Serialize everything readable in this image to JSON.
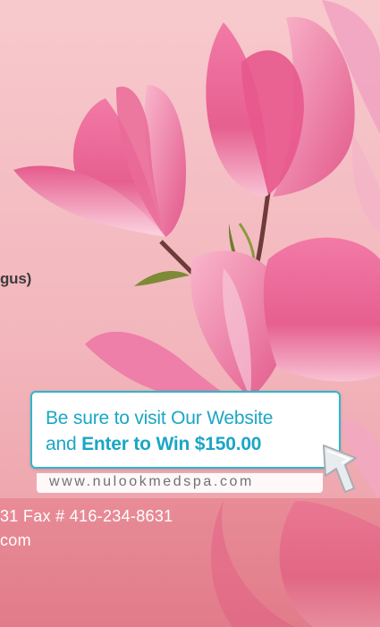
{
  "body_text": {
    "cut_word": "gus)"
  },
  "promo": {
    "line1": "Be sure to visit Our Website",
    "line2_prefix": "and ",
    "line2_bold": "Enter to Win $150.00",
    "url": "www.nulookmedspa.com"
  },
  "footer": {
    "contact_line": "31 Fax # 416-234-8631",
    "web_line": "com"
  },
  "icons": {
    "arrow": "cursor-arrow-icon",
    "flowers": "magnolia-illustration"
  },
  "colors": {
    "accent": "#1aa6c6",
    "background": "#f5c3c8",
    "blossom": "#e86b95",
    "footer_text": "#ffffff"
  }
}
